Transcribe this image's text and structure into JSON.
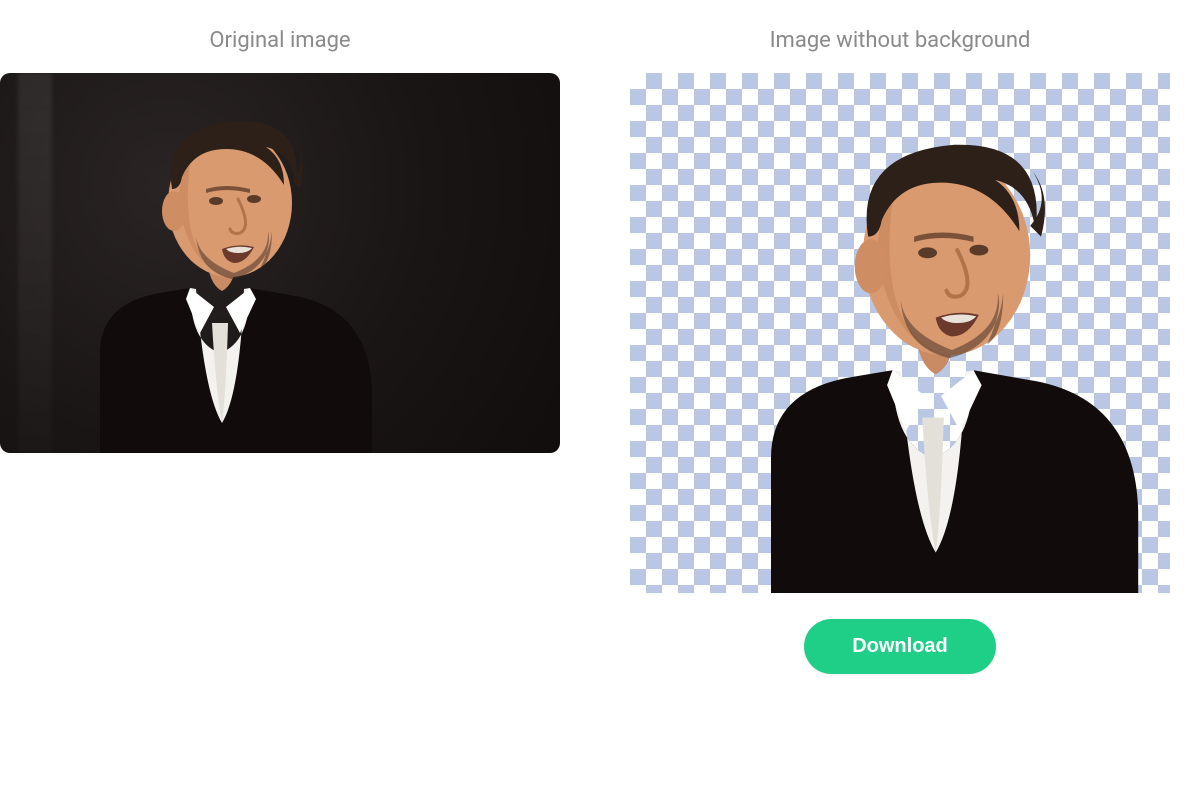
{
  "captions": {
    "original": "Original image",
    "nobg": "Image without background"
  },
  "buttons": {
    "download": "Download"
  },
  "colors": {
    "accent": "#1fce87",
    "checker_dark": "#b9c7e4",
    "checker_light": "#ffffff",
    "caption_text": "#8a8a8a"
  }
}
